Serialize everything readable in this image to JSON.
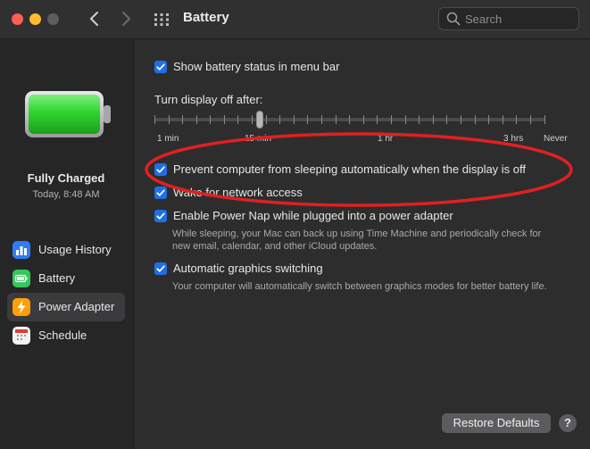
{
  "window": {
    "title": "Battery",
    "traffic_lights": [
      "close",
      "minimize",
      "zoom"
    ]
  },
  "search": {
    "placeholder": "Search"
  },
  "sidebar": {
    "status_title": "Fully Charged",
    "status_time": "Today, 8:48 AM",
    "items": [
      {
        "label": "Usage History",
        "icon": "usage-history-icon",
        "color": "#2f7cf6"
      },
      {
        "label": "Battery",
        "icon": "battery-icon",
        "color": "#35c759"
      },
      {
        "label": "Power Adapter",
        "icon": "power-adapter-icon",
        "color": "#ff9f0a"
      },
      {
        "label": "Schedule",
        "icon": "schedule-icon",
        "color": "#f2f2f2"
      }
    ],
    "selected_index": 2
  },
  "main": {
    "show_battery_status": {
      "label": "Show battery status in menu bar",
      "checked": true
    },
    "display_off": {
      "label": "Turn display off after:",
      "tick_labels": [
        "1 min",
        "15 min",
        "1 hr",
        "3 hrs",
        "Never"
      ],
      "value": "15 min"
    },
    "prevent_sleep": {
      "label": "Prevent computer from sleeping automatically when the display is off",
      "checked": true
    },
    "wake_network": {
      "label": "Wake for network access",
      "checked": true
    },
    "power_nap": {
      "label": "Enable Power Nap while plugged into a power adapter",
      "checked": true,
      "description_line1": "While sleeping, your Mac can back up using Time Machine and periodically check for",
      "description_line2": "new email, calendar, and other iCloud updates."
    },
    "graphics_switching": {
      "label": "Automatic graphics switching",
      "checked": true,
      "description": "Your computer will automatically switch between graphics modes for better battery life."
    }
  },
  "footer": {
    "restore_label": "Restore Defaults",
    "help_label": "?"
  },
  "colors": {
    "accent": "#1f6fe6",
    "annotation": "#e02020",
    "battery_fill": "#3ad63a"
  }
}
